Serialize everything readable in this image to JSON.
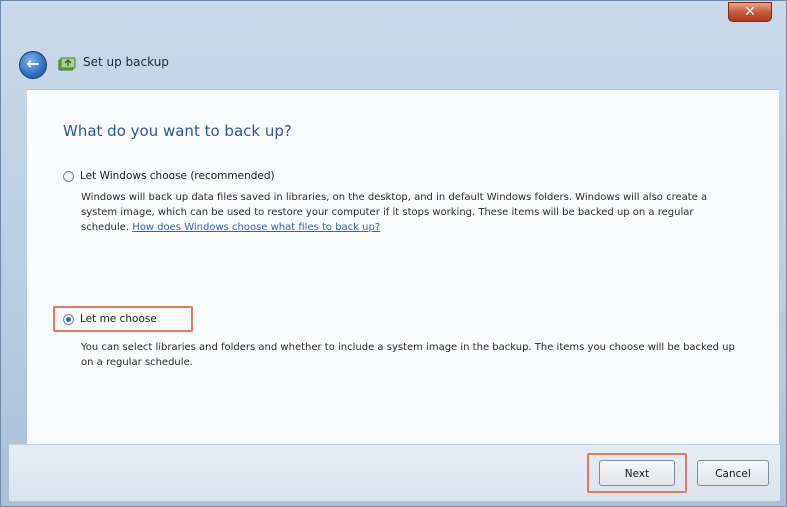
{
  "window": {
    "close_label": "✕"
  },
  "header": {
    "back_glyph": "←",
    "title": "Set up backup"
  },
  "main": {
    "heading": "What do you want to back up?",
    "options": [
      {
        "label": "Let Windows choose (recommended)",
        "selected": false,
        "description": "Windows will back up data files saved in libraries, on the desktop, and in default Windows folders. Windows will also create a system image, which can be used to restore your computer if it stops working. These items will be backed up on a regular schedule.",
        "link": "How does Windows choose what files to back up?"
      },
      {
        "label": "Let me choose",
        "selected": true,
        "description": "You can select libraries and folders and whether to include a system image in the backup. The items you choose will be backed up on a regular schedule."
      }
    ]
  },
  "footer": {
    "next_label": "Next",
    "cancel_label": "Cancel"
  },
  "colors": {
    "heading": "#2b53a1",
    "link": "#2c63c4",
    "highlight": "#e07a5f",
    "close_button": "#c75b3c"
  },
  "icons": [
    "back-arrow-icon",
    "backup-icon",
    "close-icon"
  ]
}
